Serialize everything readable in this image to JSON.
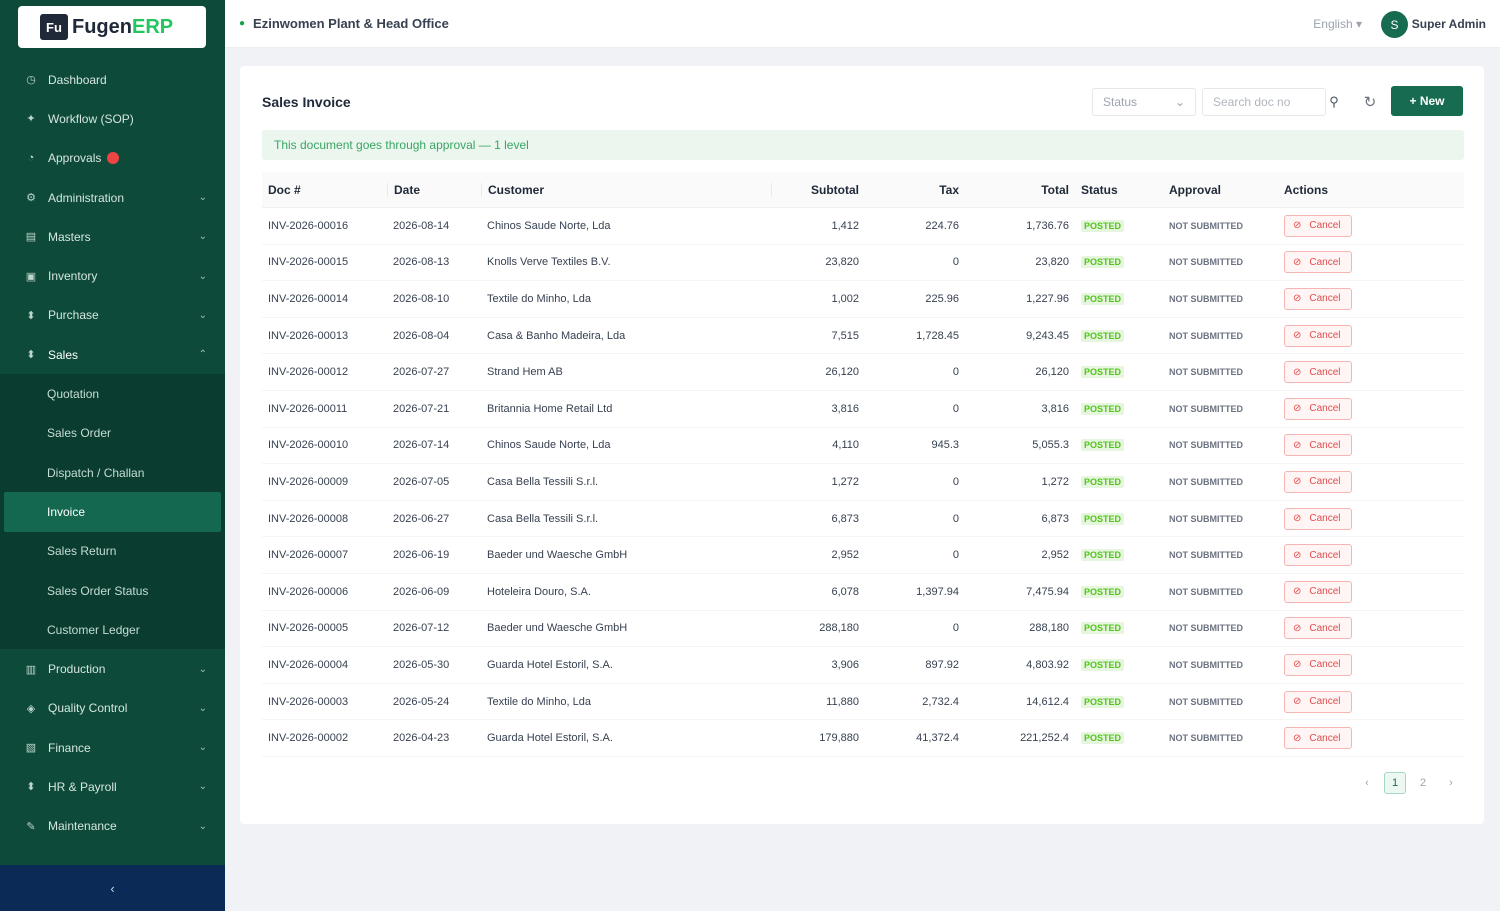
{
  "app": {
    "logo_mark": "Fu",
    "logo_text": "Fugen",
    "logo_accent": "ERP",
    "brand_color": "#166b50"
  },
  "sidebar": {
    "items": [
      {
        "icon": "dashboard-icon",
        "glyph": "◷",
        "label": "Dashboard",
        "chevron": false
      },
      {
        "icon": "workflow-icon",
        "glyph": "✦",
        "label": "Workflow (SOP)",
        "chevron": false
      },
      {
        "icon": "approvals-icon",
        "glyph": "◔",
        "label": "Approvals",
        "chevron": false,
        "badge": true
      },
      {
        "icon": "administration-icon",
        "glyph": "⚙",
        "label": "Administration",
        "chevron": true
      },
      {
        "icon": "masters-icon",
        "glyph": "▤",
        "label": "Masters",
        "chevron": true
      },
      {
        "icon": "inventory-icon",
        "glyph": "▣",
        "label": "Inventory",
        "chevron": true
      },
      {
        "icon": "purchase-icon",
        "glyph": "⬍",
        "label": "Purchase",
        "chevron": true
      },
      {
        "icon": "sales-icon",
        "glyph": "⬍",
        "label": "Sales",
        "chevron": true,
        "active": true
      }
    ],
    "sales_sub": [
      {
        "label": "Quotation"
      },
      {
        "label": "Sales Order"
      },
      {
        "label": "Dispatch / Challan"
      },
      {
        "label": "Invoice",
        "active": true
      },
      {
        "label": "Sales Return"
      },
      {
        "label": "Sales Order Status"
      },
      {
        "label": "Customer Ledger"
      }
    ],
    "items_after": [
      {
        "icon": "production-icon",
        "glyph": "▥",
        "label": "Production",
        "chevron": true
      },
      {
        "icon": "quality-icon",
        "glyph": "◈",
        "label": "Quality Control",
        "chevron": true
      },
      {
        "icon": "finance-icon",
        "glyph": "▧",
        "label": "Finance",
        "chevron": true
      },
      {
        "icon": "hr-icon",
        "glyph": "⬍",
        "label": "HR & Payroll",
        "chevron": true
      },
      {
        "icon": "maintenance-icon",
        "glyph": "✎",
        "label": "Maintenance",
        "chevron": true
      }
    ],
    "collapse_glyph": "‹"
  },
  "topbar": {
    "breadcrumb": "Ezinwomen Plant & Head Office",
    "language": "English ▾",
    "avatar_initial": "S",
    "user_name": "Super Admin"
  },
  "page": {
    "title": "Sales Invoice",
    "status_placeholder": "Status",
    "search_placeholder": "Search doc no",
    "new_label": "+ New",
    "notice": "This document goes through approval — 1 level"
  },
  "table": {
    "headers": {
      "doc": "Doc #",
      "date": "Date",
      "customer": "Customer",
      "subtotal": "Subtotal",
      "tax": "Tax",
      "total": "Total",
      "status": "Status",
      "approval": "Approval",
      "actions": "Actions"
    },
    "rows": [
      {
        "doc": "INV-2026-00016",
        "date": "2026-08-14",
        "customer": "Chinos Saude Norte, Lda",
        "subtotal": "1,412",
        "tax": "224.76",
        "total": "1,736.76",
        "status": "POSTED",
        "approval": "NOT SUBMITTED",
        "action": "Cancel"
      },
      {
        "doc": "INV-2026-00015",
        "date": "2026-08-13",
        "customer": "Knolls Verve Textiles B.V.",
        "subtotal": "23,820",
        "tax": "0",
        "total": "23,820",
        "status": "POSTED",
        "approval": "NOT SUBMITTED",
        "action": "Cancel"
      },
      {
        "doc": "INV-2026-00014",
        "date": "2026-08-10",
        "customer": "Textile do Minho, Lda",
        "subtotal": "1,002",
        "tax": "225.96",
        "total": "1,227.96",
        "status": "POSTED",
        "approval": "NOT SUBMITTED",
        "action": "Cancel"
      },
      {
        "doc": "INV-2026-00013",
        "date": "2026-08-04",
        "customer": "Casa & Banho Madeira, Lda",
        "subtotal": "7,515",
        "tax": "1,728.45",
        "total": "9,243.45",
        "status": "POSTED",
        "approval": "NOT SUBMITTED",
        "action": "Cancel"
      },
      {
        "doc": "INV-2026-00012",
        "date": "2026-07-27",
        "customer": "Strand Hem AB",
        "subtotal": "26,120",
        "tax": "0",
        "total": "26,120",
        "status": "POSTED",
        "approval": "NOT SUBMITTED",
        "action": "Cancel"
      },
      {
        "doc": "INV-2026-00011",
        "date": "2026-07-21",
        "customer": "Britannia Home Retail Ltd",
        "subtotal": "3,816",
        "tax": "0",
        "total": "3,816",
        "status": "POSTED",
        "approval": "NOT SUBMITTED",
        "action": "Cancel"
      },
      {
        "doc": "INV-2026-00010",
        "date": "2026-07-14",
        "customer": "Chinos Saude Norte, Lda",
        "subtotal": "4,110",
        "tax": "945.3",
        "total": "5,055.3",
        "status": "POSTED",
        "approval": "NOT SUBMITTED",
        "action": "Cancel"
      },
      {
        "doc": "INV-2026-00009",
        "date": "2026-07-05",
        "customer": "Casa Bella Tessili S.r.l.",
        "subtotal": "1,272",
        "tax": "0",
        "total": "1,272",
        "status": "POSTED",
        "approval": "NOT SUBMITTED",
        "action": "Cancel"
      },
      {
        "doc": "INV-2026-00008",
        "date": "2026-06-27",
        "customer": "Casa Bella Tessili S.r.l.",
        "subtotal": "6,873",
        "tax": "0",
        "total": "6,873",
        "status": "POSTED",
        "approval": "NOT SUBMITTED",
        "action": "Cancel"
      },
      {
        "doc": "INV-2026-00007",
        "date": "2026-06-19",
        "customer": "Baeder und Waesche GmbH",
        "subtotal": "2,952",
        "tax": "0",
        "total": "2,952",
        "status": "POSTED",
        "approval": "NOT SUBMITTED",
        "action": "Cancel"
      },
      {
        "doc": "INV-2026-00006",
        "date": "2026-06-09",
        "customer": "Hoteleira Douro, S.A.",
        "subtotal": "6,078",
        "tax": "1,397.94",
        "total": "7,475.94",
        "status": "POSTED",
        "approval": "NOT SUBMITTED",
        "action": "Cancel"
      },
      {
        "doc": "INV-2026-00005",
        "date": "2026-07-12",
        "customer": "Baeder und Waesche GmbH",
        "subtotal": "288,180",
        "tax": "0",
        "total": "288,180",
        "status": "POSTED",
        "approval": "NOT SUBMITTED",
        "action": "Cancel"
      },
      {
        "doc": "INV-2026-00004",
        "date": "2026-05-30",
        "customer": "Guarda Hotel Estoril, S.A.",
        "subtotal": "3,906",
        "tax": "897.92",
        "total": "4,803.92",
        "status": "POSTED",
        "approval": "NOT SUBMITTED",
        "action": "Cancel"
      },
      {
        "doc": "INV-2026-00003",
        "date": "2026-05-24",
        "customer": "Textile do Minho, Lda",
        "subtotal": "11,880",
        "tax": "2,732.4",
        "total": "14,612.4",
        "status": "POSTED",
        "approval": "NOT SUBMITTED",
        "action": "Cancel"
      },
      {
        "doc": "INV-2026-00002",
        "date": "2026-04-23",
        "customer": "Guarda Hotel Estoril, S.A.",
        "subtotal": "179,880",
        "tax": "41,372.4",
        "total": "221,252.4",
        "status": "POSTED",
        "approval": "NOT SUBMITTED",
        "action": "Cancel"
      }
    ]
  },
  "pagination": {
    "prev": "‹",
    "pages": [
      "1",
      "2"
    ],
    "current": "1",
    "next": "›"
  }
}
